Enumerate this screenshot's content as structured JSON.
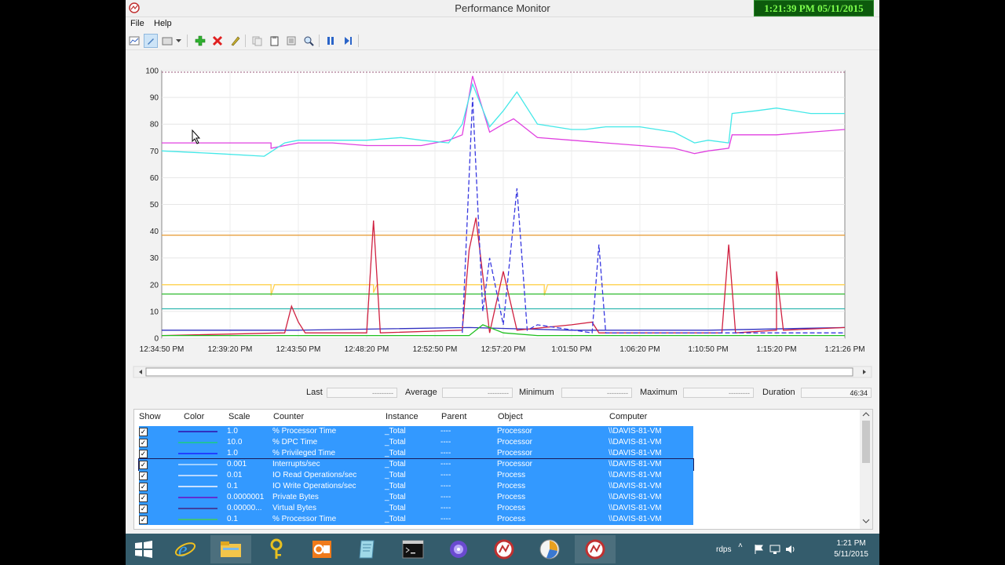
{
  "window": {
    "title": "Performance Monitor"
  },
  "recording_overlay": {
    "text": "1:21:39 PM 05/11/2015"
  },
  "menu": {
    "file": "File",
    "help": "Help"
  },
  "toolbar": {
    "icons": [
      "view-graph-icon",
      "highlight-icon",
      "change-graph-type-icon",
      "add-counter-icon",
      "delete-counter-icon",
      "properties-pencil-icon",
      "copy-properties-icon",
      "paste-counter-list-icon",
      "properties-icon",
      "zoom-icon",
      "freeze-display-icon",
      "update-data-icon"
    ]
  },
  "chart_data": {
    "type": "line",
    "title": "",
    "xlabel": "",
    "ylabel": "",
    "ylim": [
      0,
      100
    ],
    "y_ticks": [
      "100",
      "90",
      "80",
      "70",
      "60",
      "50",
      "40",
      "30",
      "20",
      "10",
      "0"
    ],
    "x_ticks": [
      "12:34:50 PM",
      "12:39:20 PM",
      "12:43:50 PM",
      "12:48:20 PM",
      "12:52:50 PM",
      "12:57:20 PM",
      "1:01:50 PM",
      "1:06:20 PM",
      "1:10:50 PM",
      "1:15:20 PM",
      "1:21:26 PM"
    ],
    "grid": true,
    "legend": "none",
    "series": [
      {
        "color": "#e040e0",
        "x": [
          0,
          0.08,
          0.16,
          0.16,
          0.18,
          0.2,
          0.25,
          0.3,
          0.35,
          0.38,
          0.42,
          0.44,
          0.455,
          0.48,
          0.5,
          0.515,
          0.55,
          0.6,
          0.65,
          0.7,
          0.75,
          0.78,
          0.8,
          0.83,
          0.835,
          0.9,
          0.95,
          1
        ],
        "values": [
          73,
          73,
          73,
          71,
          72,
          73,
          73,
          72,
          72,
          72,
          74,
          76,
          98,
          77,
          80,
          82,
          75,
          74,
          73,
          72,
          71,
          69,
          70,
          71,
          76,
          76,
          77,
          78
        ]
      },
      {
        "color": "#44e8e8",
        "x": [
          0,
          0.08,
          0.15,
          0.18,
          0.2,
          0.25,
          0.3,
          0.35,
          0.38,
          0.42,
          0.44,
          0.455,
          0.48,
          0.5,
          0.52,
          0.55,
          0.6,
          0.62,
          0.65,
          0.7,
          0.75,
          0.78,
          0.8,
          0.83,
          0.835,
          0.87,
          0.9,
          0.95,
          1
        ],
        "values": [
          70,
          69,
          68,
          73,
          74,
          74,
          74,
          75,
          74,
          73,
          80,
          95,
          79,
          85,
          92,
          80,
          78,
          78,
          79,
          79,
          77,
          73,
          74,
          73,
          84,
          85,
          86,
          84,
          84
        ]
      },
      {
        "color": "#e8a040",
        "x": [
          0,
          1
        ],
        "values": [
          38.5,
          38.5
        ]
      },
      {
        "color": "#ffd24d",
        "x": [
          0,
          0.16,
          0.16,
          0.165,
          0.31,
          0.31,
          0.315,
          0.56,
          0.56,
          0.565,
          1
        ],
        "values": [
          20,
          20,
          16,
          20,
          20,
          17,
          20,
          20,
          16,
          20,
          20
        ]
      },
      {
        "color": "#40c040",
        "x": [
          0,
          1
        ],
        "values": [
          16.5,
          16.5
        ]
      },
      {
        "color": "#30b8b0",
        "x": [
          0,
          1
        ],
        "values": [
          11,
          11
        ]
      },
      {
        "color": "#3030c0",
        "x": [
          0,
          0.2,
          0.45,
          0.6,
          0.8,
          1
        ],
        "values": [
          3,
          3,
          4,
          3,
          3,
          4
        ]
      },
      {
        "color": "#d02040",
        "x": [
          0,
          0.18,
          0.19,
          0.2,
          0.21,
          0.3,
          0.31,
          0.32,
          0.44,
          0.45,
          0.46,
          0.48,
          0.5,
          0.52,
          0.6,
          0.63,
          0.64,
          0.82,
          0.83,
          0.84,
          0.9,
          0.9,
          0.91,
          1
        ],
        "values": [
          1,
          2,
          12,
          6,
          2,
          2,
          44,
          2,
          3,
          33,
          45,
          2,
          25,
          3,
          5,
          6,
          2,
          2,
          35,
          2,
          3,
          25,
          3,
          4
        ]
      },
      {
        "color": "#3838e0",
        "dashed": true,
        "x": [
          0.44,
          0.455,
          0.47,
          0.48,
          0.5,
          0.52,
          0.535,
          0.55,
          0.63,
          0.64,
          0.65,
          1
        ],
        "values": [
          2,
          90,
          10,
          30,
          5,
          56,
          3,
          5,
          2,
          35,
          2,
          2
        ]
      },
      {
        "color": "#20c020",
        "x": [
          0,
          0.2,
          0.45,
          0.47,
          0.5,
          0.55,
          0.6,
          1
        ],
        "values": [
          1,
          1,
          1,
          5,
          2,
          1,
          1,
          1
        ]
      }
    ]
  },
  "statistics": {
    "last_label": "Last",
    "last_value": "---------",
    "average_label": "Average",
    "average_value": "---------",
    "minimum_label": "Minimum",
    "minimum_value": "---------",
    "maximum_label": "Maximum",
    "maximum_value": "---------",
    "duration_label": "Duration",
    "duration_value": "46:34"
  },
  "counter_table": {
    "columns": [
      "Show",
      "Color",
      "Scale",
      "Counter",
      "Instance",
      "Parent",
      "Object",
      "Computer"
    ],
    "rows": [
      {
        "color": "#3030c0",
        "scale": "1.0",
        "counter": "% Processor Time",
        "instance": "_Total",
        "parent": "----",
        "object": "Processor",
        "computer": "\\\\DAVIS-81-VM"
      },
      {
        "color": "#20c0a0",
        "scale": "10.0",
        "counter": "% DPC Time",
        "instance": "_Total",
        "parent": "----",
        "object": "Processor",
        "computer": "\\\\DAVIS-81-VM"
      },
      {
        "color": "#2040ff",
        "scale": "1.0",
        "counter": "% Privileged Time",
        "instance": "_Total",
        "parent": "----",
        "object": "Processor",
        "computer": "\\\\DAVIS-81-VM"
      },
      {
        "color": "#9fd0ff",
        "scale": "0.001",
        "counter": "Interrupts/sec",
        "instance": "_Total",
        "parent": "----",
        "object": "Processor",
        "computer": "\\\\DAVIS-81-VM"
      },
      {
        "color": "#b8d8ff",
        "scale": "0.01",
        "counter": "IO Read Operations/sec",
        "instance": "_Total",
        "parent": "----",
        "object": "Process",
        "computer": "\\\\DAVIS-81-VM"
      },
      {
        "color": "#c8e0ff",
        "scale": "0.1",
        "counter": "IO Write Operations/sec",
        "instance": "_Total",
        "parent": "----",
        "object": "Process",
        "computer": "\\\\DAVIS-81-VM"
      },
      {
        "color": "#6030d0",
        "scale": "0.0000001",
        "counter": "Private Bytes",
        "instance": "_Total",
        "parent": "----",
        "object": "Process",
        "computer": "\\\\DAVIS-81-VM"
      },
      {
        "color": "#4040a0",
        "scale": "0.00000...",
        "counter": "Virtual Bytes",
        "instance": "_Total",
        "parent": "----",
        "object": "Process",
        "computer": "\\\\DAVIS-81-VM"
      },
      {
        "color": "#40c080",
        "scale": "0.1",
        "counter": "% Processor Time",
        "instance": "_Total",
        "parent": "----",
        "object": "Process",
        "computer": "\\\\DAVIS-81-VM"
      }
    ]
  },
  "taskbar": {
    "items": [
      "start-icon",
      "internet-explorer-icon",
      "file-explorer-icon",
      "key-icon",
      "outlook-icon",
      "notepad-icon",
      "command-prompt-icon",
      "mouse-icon",
      "performance-monitor-icon",
      "resource-monitor-icon",
      "performance-monitor-active-icon"
    ],
    "tray_text": "rdps",
    "time": "1:21 PM",
    "date": "5/11/2015"
  }
}
